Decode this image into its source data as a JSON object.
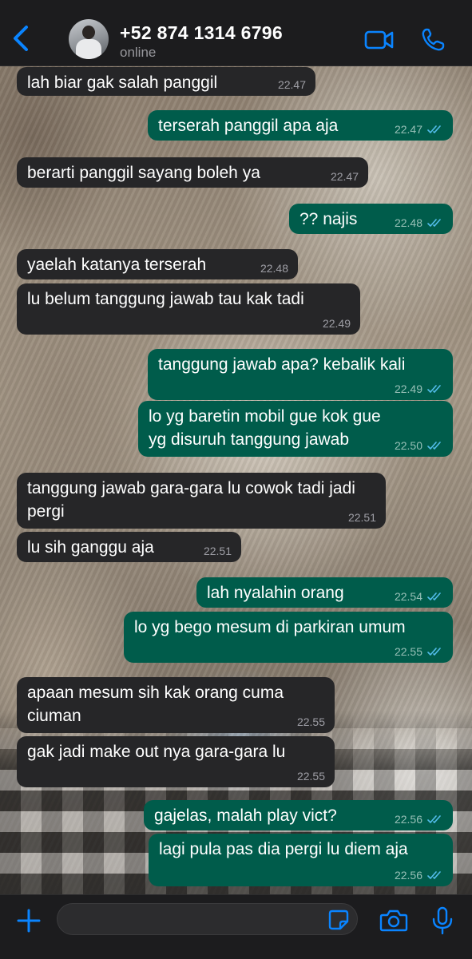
{
  "header": {
    "contact_name": "+52 874 1314 6796",
    "status": "online",
    "icons": [
      "chevron-left-icon",
      "video-camera-icon",
      "phone-icon"
    ]
  },
  "messages": [
    {
      "dir": "in",
      "text": "lah biar gak salah panggil",
      "time": "22.47"
    },
    {
      "dir": "out",
      "text": "terserah panggil apa aja",
      "time": "22.47"
    },
    {
      "dir": "in",
      "text": "berarti panggil sayang boleh ya",
      "time": "22.47"
    },
    {
      "dir": "out",
      "text": "?? najis",
      "time": "22.48"
    },
    {
      "dir": "in",
      "text": "yaelah katanya terserah",
      "time": "22.48"
    },
    {
      "dir": "in",
      "text": "lu belum tanggung jawab tau kak tadi",
      "time": "22.49"
    },
    {
      "dir": "out",
      "text": "tanggung jawab apa? kebalik kali",
      "time": "22.49"
    },
    {
      "dir": "out",
      "text": "lo yg baretin mobil gue kok gue yg disuruh tanggung jawab",
      "time": "22.50"
    },
    {
      "dir": "in",
      "text": "tanggung jawab gara-gara lu cowok tadi jadi pergi",
      "time": "22.51"
    },
    {
      "dir": "in",
      "text": "lu sih ganggu aja",
      "time": "22.51"
    },
    {
      "dir": "out",
      "text": "lah nyalahin orang",
      "time": "22.54"
    },
    {
      "dir": "out",
      "text": "lo yg bego mesum di parkiran umum",
      "time": "22.55"
    },
    {
      "dir": "in",
      "text": "apaan mesum sih kak orang cuma ciuman",
      "time": "22.55"
    },
    {
      "dir": "in",
      "text": "gak jadi make out nya gara-gara lu",
      "time": "22.55"
    },
    {
      "dir": "out",
      "text": "gajelas, malah play vict?",
      "time": "22.56"
    },
    {
      "dir": "out",
      "text": "lagi pula pas dia pergi lu diem aja",
      "time": "22.56"
    }
  ],
  "colors": {
    "incoming_bubble": "#262628",
    "outgoing_bubble": "#005c4b",
    "read_ticks": "#53bdeb",
    "accent": "#0a84ff"
  },
  "input_bar": {
    "placeholder": "",
    "icons": [
      "plus-icon",
      "sticker-icon",
      "camera-icon",
      "microphone-icon"
    ]
  }
}
